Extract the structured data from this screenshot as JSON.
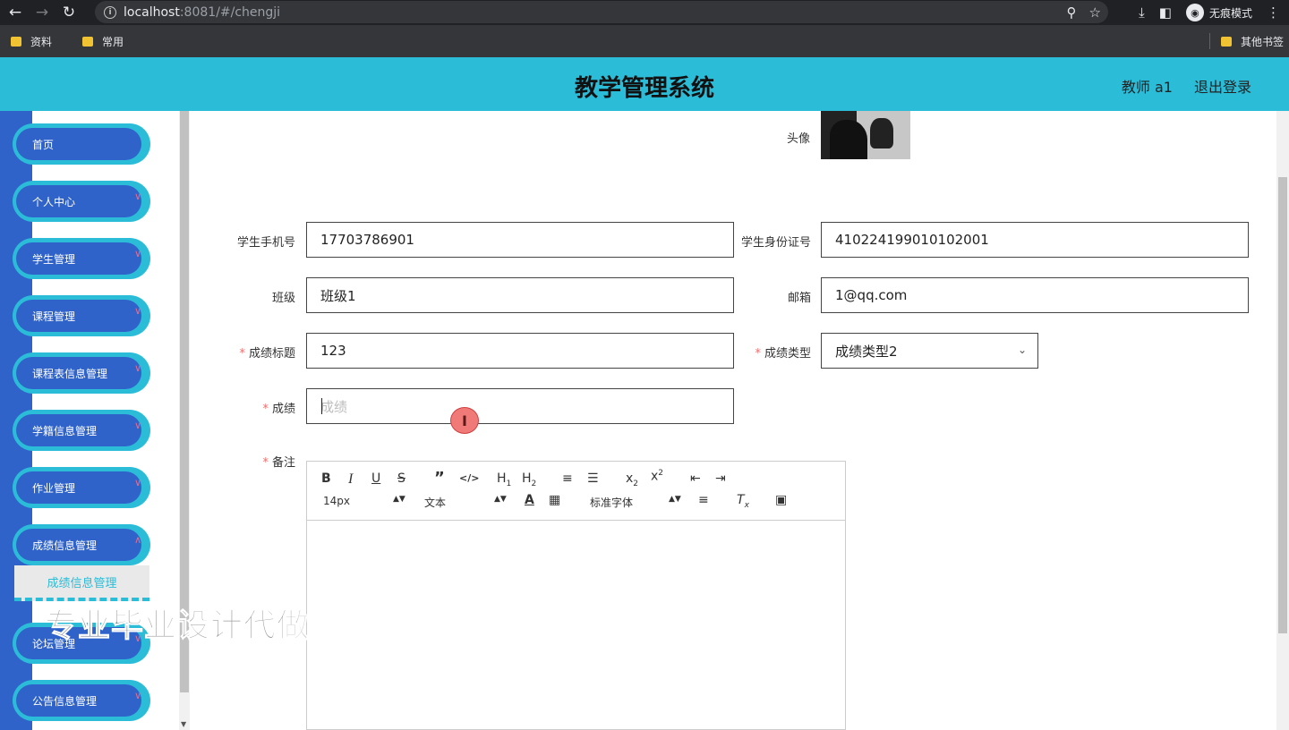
{
  "browser": {
    "url_host": "localhost",
    "url_rest": ":8081/#/chengji",
    "incognito_label": "无痕模式",
    "bookmarks": [
      "资料",
      "常用"
    ],
    "other_bookmarks": "其他书签"
  },
  "header": {
    "title": "教学管理系统",
    "user": "教师 a1",
    "logout": "退出登录"
  },
  "sidebar": {
    "items": [
      {
        "label": "首页"
      },
      {
        "label": "个人中心"
      },
      {
        "label": "学生管理"
      },
      {
        "label": "课程管理"
      },
      {
        "label": "课程表信息管理"
      },
      {
        "label": "学籍信息管理"
      },
      {
        "label": "作业管理"
      },
      {
        "label": "成绩信息管理"
      },
      {
        "label": "论坛管理"
      },
      {
        "label": "公告信息管理"
      }
    ],
    "submenu_active": "成绩信息管理"
  },
  "form": {
    "avatar_label": "头像",
    "phone_label": "学生手机号",
    "phone_value": "17703786901",
    "id_label": "学生身份证号",
    "id_value": "410224199010102001",
    "class_label": "班级",
    "class_value": "班级1",
    "email_label": "邮箱",
    "email_value": "1@qq.com",
    "score_title_label": "成绩标题",
    "score_title_value": "123",
    "score_type_label": "成绩类型",
    "score_type_value": "成绩类型2",
    "score_label": "成绩",
    "score_placeholder": "成绩",
    "remark_label": "备注"
  },
  "editor": {
    "font_size": "14px",
    "paragraph": "文本",
    "font_family": "标准字体"
  },
  "watermark": "专业毕业设计代做"
}
